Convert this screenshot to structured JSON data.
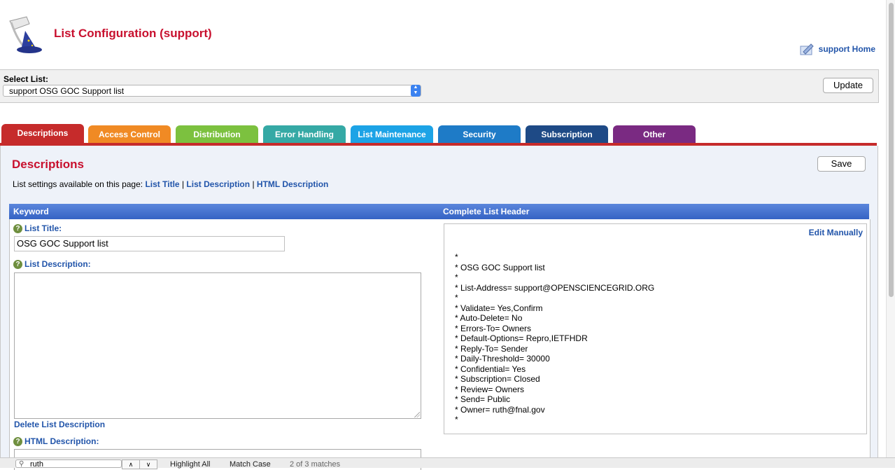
{
  "header": {
    "title": "List Configuration (support)",
    "home_link": "support Home"
  },
  "select_list": {
    "label": "Select List:",
    "value": "support OSG GOC Support list",
    "update_label": "Update"
  },
  "tabs": [
    {
      "label": "Descriptions",
      "color": "#c62b2b",
      "active": true
    },
    {
      "label": "Access Control",
      "color": "#f08a24"
    },
    {
      "label": "Distribution",
      "color": "#7cc13f"
    },
    {
      "label": "Error Handling",
      "color": "#35a9a5"
    },
    {
      "label": "List Maintenance",
      "color": "#1ca3e6"
    },
    {
      "label": "Security",
      "color": "#1e7bc7"
    },
    {
      "label": "Subscription",
      "color": "#1e4a86"
    },
    {
      "label": "Other",
      "color": "#7a2a82"
    }
  ],
  "panel": {
    "title": "Descriptions",
    "save_label": "Save",
    "settings_prefix": "List settings available on this page:",
    "links": [
      "List Title",
      "List Description",
      "HTML Description"
    ],
    "separator": "|"
  },
  "table": {
    "col_keyword": "Keyword",
    "col_header": "Complete List Header"
  },
  "fields": {
    "list_title_label": "List Title:",
    "list_title_value": "OSG GOC Support list",
    "list_description_label": "List Description:",
    "delete_description": "Delete List Description",
    "html_description_label": "HTML Description:"
  },
  "list_header": {
    "edit_label": "Edit Manually",
    "lines": [
      "*",
      "* OSG GOC Support list",
      "*",
      "* List-Address= support@OPENSCIENCEGRID.ORG",
      "*",
      "* Validate= Yes,Confirm",
      "* Auto-Delete= No",
      "* Errors-To= Owners",
      "* Default-Options= Repro,IETFHDR",
      "* Reply-To= Sender",
      "* Daily-Threshold= 30000",
      "* Confidential= Yes",
      "* Subscription= Closed",
      "* Review= Owners",
      "* Send= Public",
      "* Owner= ruth@fnal.gov",
      "*"
    ]
  },
  "findbar": {
    "query": "ruth",
    "highlight_all": "Highlight All",
    "match_case": "Match Case",
    "matches": "2 of 3 matches"
  }
}
